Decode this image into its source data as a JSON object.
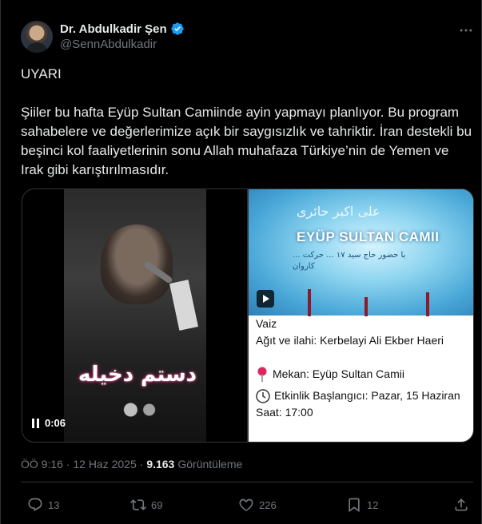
{
  "author": {
    "name": "Dr. Abdulkadir Şen",
    "handle": "@SennAbdulkadir"
  },
  "tweet": {
    "text": "UYARI\n\nŞiiler bu hafta Eyüp Sultan Camiinde ayin yapmayı planlıyor. Bu program sahabelere ve değerlerimize açık bir saygısızlık ve tahriktir. İran destekli bu beşinci kol faaliyetlerinin sonu Allah muhafaza Türkiye’nin de Yemen ve Irak gibi karıştırılmasıdır."
  },
  "media": {
    "left_video": {
      "overlay_text": "دستم دخیله",
      "time": "0:06"
    },
    "right_video": {
      "banner_title": "EYÜP SULTAN CAMII",
      "banner_arabic_top": "علی اکبر حائری",
      "banner_arabic_small": "با حضور حاج سید ۱۷ ... حرکت ... کاروان",
      "info_line1": "Vaiz",
      "info_line2": "Ağıt ve ilahi: Kerbelayi Ali Ekber Haeri",
      "location": "Mekan: Eyüp Sultan Camii",
      "start": "Etkinlik Başlangıcı: Pazar, 15 Haziran",
      "time": "Saat: 17:00"
    }
  },
  "meta": {
    "timestamp": "ÖÖ 9:16 · 12 Haz 2025 ·",
    "views_count": "9.163",
    "views_label": "Görüntüleme"
  },
  "actions": {
    "replies": "13",
    "reposts": "69",
    "likes": "226",
    "bookmarks": "12"
  },
  "colors": {
    "background": "#000000",
    "text": "#e7e9ea",
    "secondary": "#71767b",
    "verified": "#1d9bf0",
    "border": "#2f3336"
  }
}
